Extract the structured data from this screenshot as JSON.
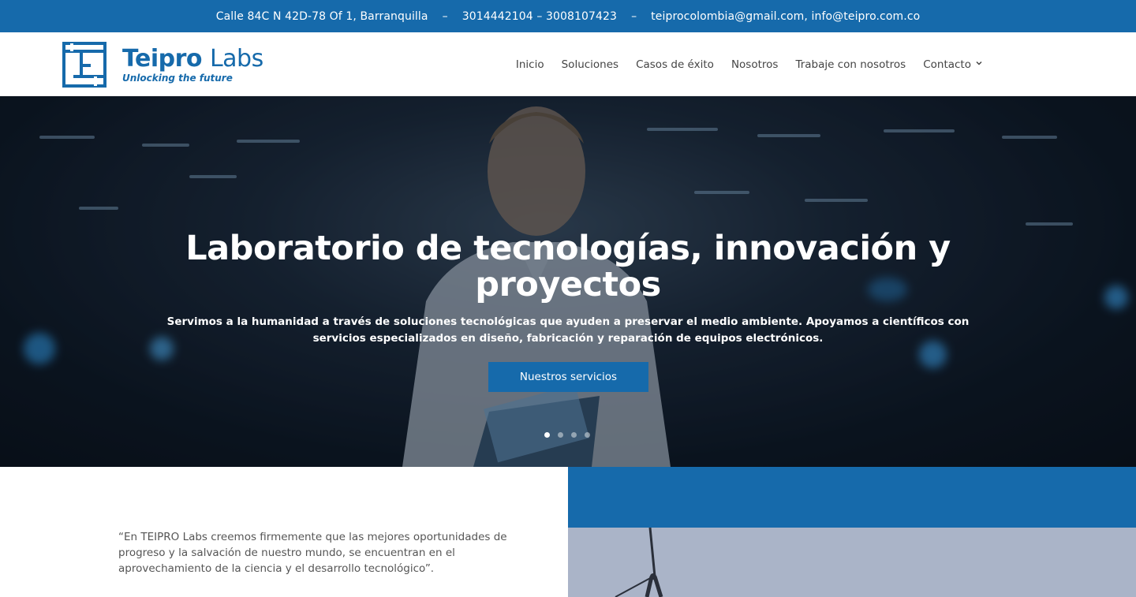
{
  "topbar": {
    "address": "Calle 84C N 42D-78 Of 1, Barranquilla",
    "separator": "–",
    "phones": "3014442104 – 3008107423",
    "emails": "teiprocolombia@gmail.com, info@teipro.com.co"
  },
  "logo": {
    "name_bold": "Teipro",
    "name_light": "Labs",
    "tagline": "Unlocking the future"
  },
  "nav": {
    "items": [
      {
        "label": "Inicio"
      },
      {
        "label": "Soluciones"
      },
      {
        "label": "Casos de éxito"
      },
      {
        "label": "Nosotros"
      },
      {
        "label": "Trabaje con nosotros"
      },
      {
        "label": "Contacto",
        "has_dropdown": true
      }
    ]
  },
  "hero": {
    "title": "Laboratorio de tecnologías, innovación y proyectos",
    "subtitle": "Servimos a la humanidad a través de soluciones tecnológicas que ayuden a preservar el medio ambiente. Apoyamos a científicos con servicios especializados en diseño, fabricación y reparación de equipos electrónicos.",
    "cta_label": "Nuestros servicios",
    "slides": 4,
    "active_slide": 1
  },
  "about": {
    "quote": "“En TEIPRO Labs creemos firmemente que las mejores oportunidades de progreso y la salvación de nuestro mundo, se encuentran en el aprovechamiento de la ciencia y el desarrollo tecnológico”."
  },
  "colors": {
    "brand_blue": "#166aab",
    "white": "#ffffff"
  }
}
